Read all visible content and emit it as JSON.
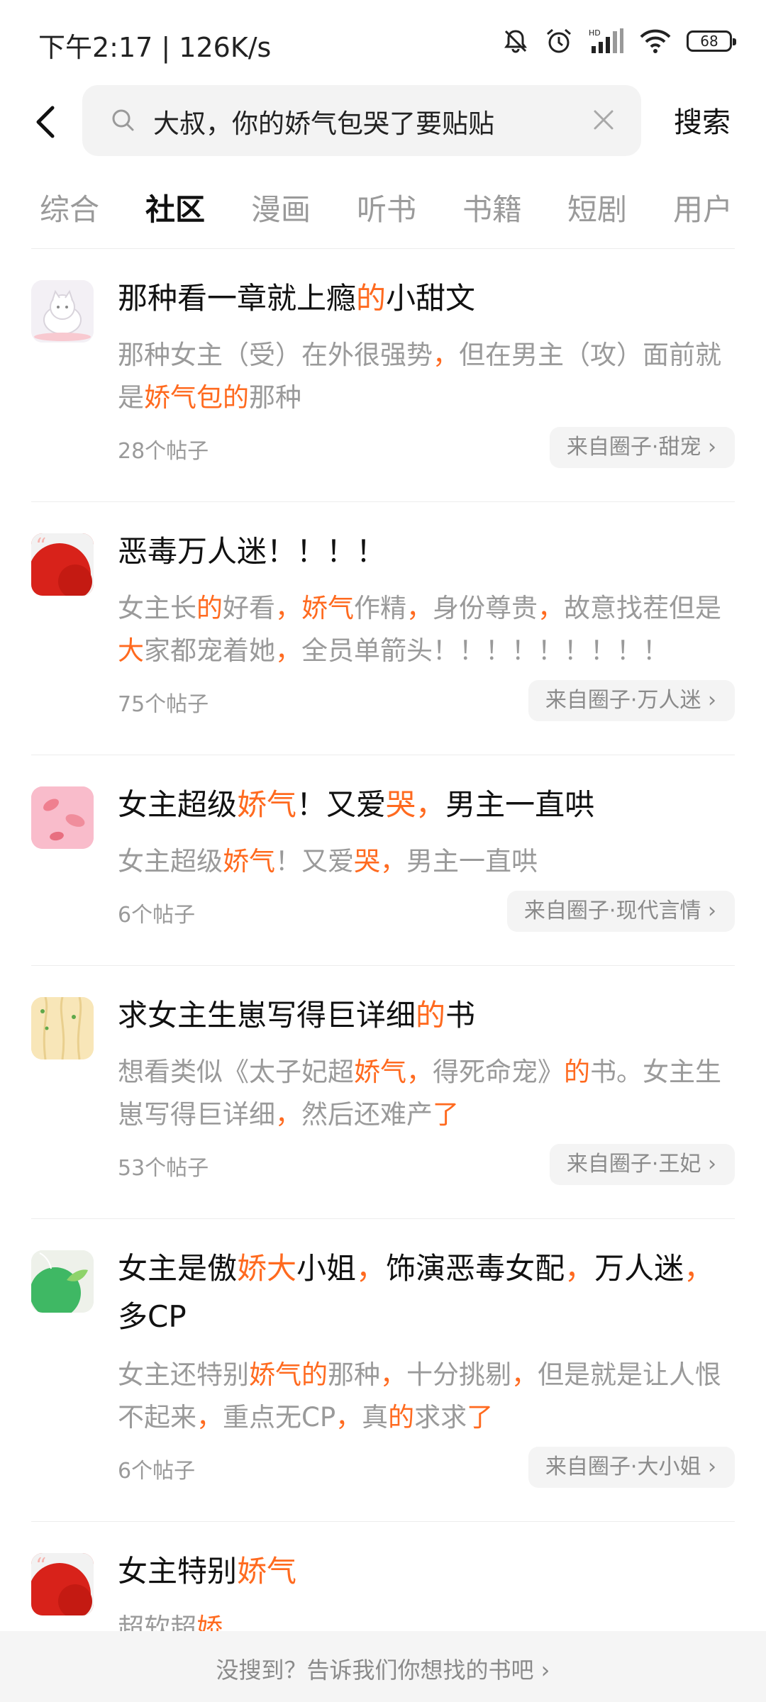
{
  "status_bar": {
    "time": "下午2:17 | 126K/s",
    "battery": "68"
  },
  "search": {
    "query": "大叔，你的娇气包哭了要贴贴",
    "submit_label": "搜索"
  },
  "tabs": [
    {
      "label": "综合"
    },
    {
      "label": "社区"
    },
    {
      "label": "漫画"
    },
    {
      "label": "听书"
    },
    {
      "label": "书籍"
    },
    {
      "label": "短剧"
    },
    {
      "label": "用户"
    }
  ],
  "active_tab": "社区",
  "highlight_color": "#ff6a1f",
  "results": [
    {
      "title": "那种看一章就上瘾的小甜文",
      "desc": "那种女主（受）在外很强势，但在男主（攻）面前就是娇气包的那种",
      "count": "28个帖子",
      "circle": "来自圈子·甜宠 ›"
    },
    {
      "title": "恶毒万人迷！！！！",
      "desc": "女主长的好看，娇气作精，身份尊贵，故意找茬但是大家都宠着她，全员单箭头！！！！！！！！！",
      "count": "75个帖子",
      "circle": "来自圈子·万人迷 ›"
    },
    {
      "title": "女主超级娇气！又爱哭，男主一直哄",
      "desc": "女主超级娇气！又爱哭，男主一直哄",
      "count": "6个帖子",
      "circle": "来自圈子·现代言情 ›"
    },
    {
      "title": "求女主生崽写得巨详细的书",
      "desc": "想看类似《太子妃超娇气，得死命宠》的书。女主生崽写得巨详细，然后还难产了",
      "count": "53个帖子",
      "circle": "来自圈子·王妃 ›"
    },
    {
      "title": "女主是傲娇大小姐，饰演恶毒女配，万人迷，多CP",
      "desc": "女主还特别娇气的那种，十分挑剔，但是就是让人恨不起来，重点无CP，真的求求了",
      "count": "6个帖子",
      "circle": "来自圈子·大小姐 ›"
    },
    {
      "title": "女主特别娇气",
      "desc": "超软超娇"
    }
  ],
  "bottom_banner": "没搜到？告诉我们你想找的书吧 ›"
}
